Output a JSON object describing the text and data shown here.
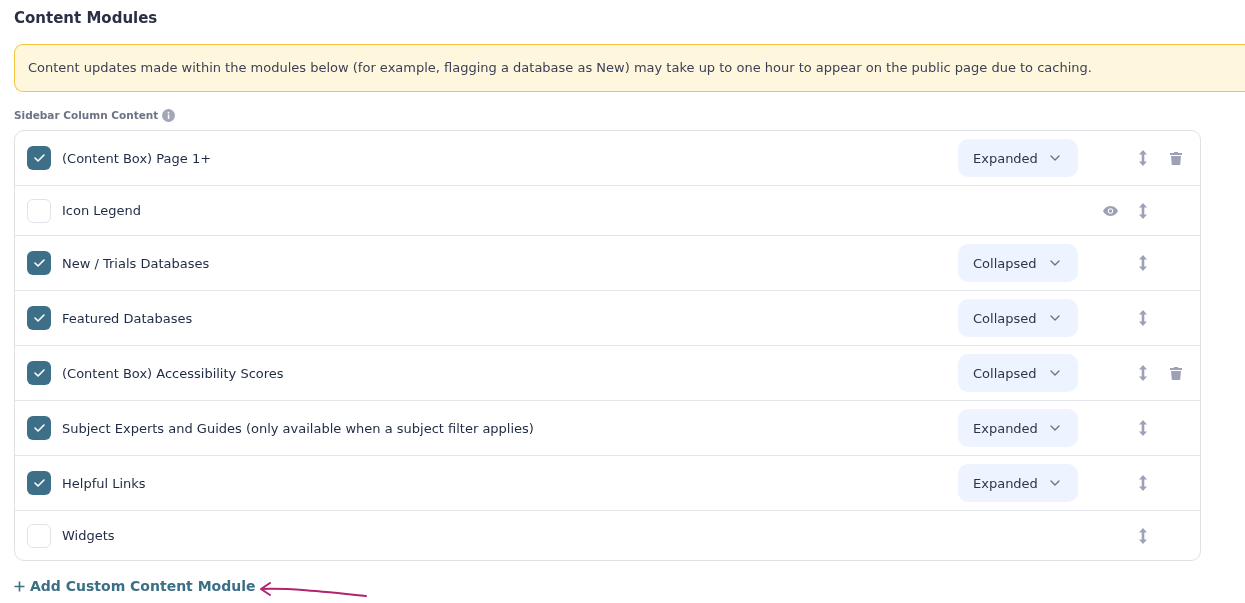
{
  "section": {
    "title": "Content Modules"
  },
  "notice": {
    "text": "Content updates made within the modules below (for example, flagging a database as New) may take up to one hour to appear on the public page due to caching."
  },
  "list": {
    "label": "Sidebar Column Content",
    "modules": [
      {
        "name": "(Content Box) Page 1+",
        "checked": true,
        "display": "Expanded",
        "viewable": false,
        "deletable": true
      },
      {
        "name": "Icon Legend",
        "checked": false,
        "viewable": true,
        "deletable": false
      },
      {
        "name": "New / Trials Databases",
        "checked": true,
        "display": "Collapsed",
        "viewable": false,
        "deletable": false
      },
      {
        "name": "Featured Databases",
        "checked": true,
        "display": "Collapsed",
        "viewable": false,
        "deletable": false
      },
      {
        "name": "(Content Box) Accessibility Scores",
        "checked": true,
        "display": "Collapsed",
        "viewable": false,
        "deletable": true
      },
      {
        "name": "Subject Experts and Guides (only available when a subject filter applies)",
        "checked": true,
        "display": "Expanded",
        "viewable": false,
        "deletable": false
      },
      {
        "name": "Helpful Links",
        "checked": true,
        "display": "Expanded",
        "viewable": false,
        "deletable": false
      },
      {
        "name": "Widgets",
        "checked": false,
        "viewable": false,
        "deletable": false
      }
    ]
  },
  "add_link": {
    "label": "Add Custom Content Module"
  }
}
